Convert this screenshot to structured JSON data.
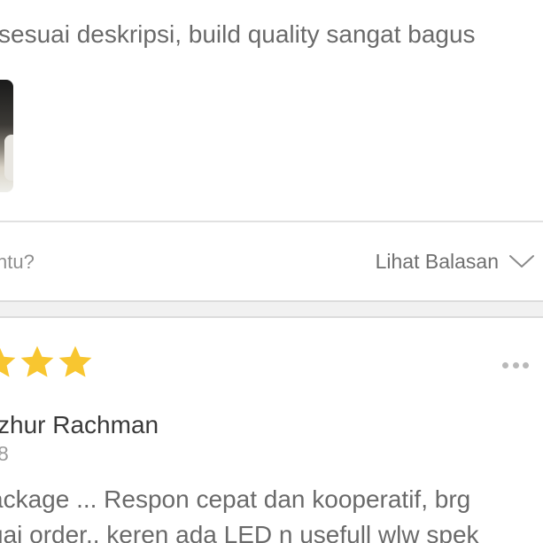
{
  "previous_review": {
    "text": "sesuai deskripsi, build quality sangat bagus",
    "photo_icon": "product-photo-thumbnail"
  },
  "helpful_bar": {
    "question": "ntu?",
    "see_replies_label": "Lihat Balasan",
    "see_replies_icon": "chevron-down-icon"
  },
  "review": {
    "rating": {
      "visible_stars": 3,
      "color": "#f8c630",
      "icon": "star-icon"
    },
    "menu_icon": "more-options-icon",
    "reviewer_name": "zhur Rachman",
    "date": "8",
    "body_lines": [
      "ackage ... Respon cepat dan kooperatif, brg",
      "uai order.. keren ada LED n usefull wlw spek"
    ]
  },
  "colors": {
    "text_primary": "#3a3a3a",
    "text_secondary": "#6a6a6a",
    "text_muted": "#9a9a9a",
    "divider": "#e1e1e1",
    "section_gap": "#f1f1f1",
    "star": "#f8c630"
  }
}
